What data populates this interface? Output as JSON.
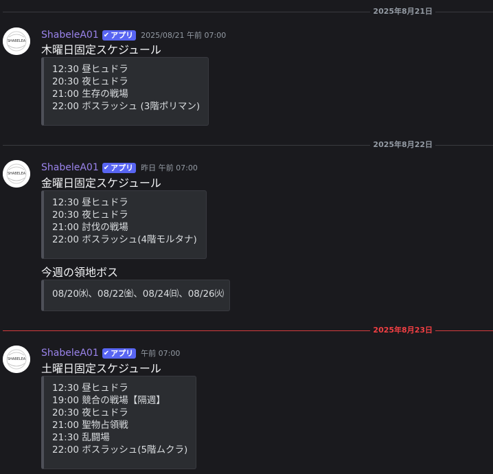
{
  "dividers": [
    {
      "label": "2025年8月21日",
      "today": false
    },
    {
      "label": "2025年8月22日",
      "today": false
    },
    {
      "label": "2025年8月23日",
      "today": true
    }
  ],
  "messages": [
    {
      "author": "ShabeleA01",
      "badge": "アプリ",
      "time": "2025/08/21 午前 07:00",
      "title": "木曜日固定スケジュール",
      "lines": [
        "12:30 昼ヒュドラ",
        "20:30 夜ヒュドラ",
        "21:00 生存の戦場",
        "22:00 ボスラッシュ (3階ポリマン)"
      ]
    },
    {
      "author": "ShabeleA01",
      "badge": "アプリ",
      "time": "昨日 午前 07:00",
      "title": "金曜日固定スケジュール",
      "lines": [
        "12:30 昼ヒュドラ",
        "20:30 夜ヒュドラ",
        "21:00 討伐の戦場",
        "22:00 ボスラッシュ(4階モルタナ)"
      ],
      "extra_title": "今週の領地ボス",
      "extra_lines": [
        "08/20㈬、08/22㈮、08/24㈰、08/26㈫"
      ]
    },
    {
      "author": "ShabeleA01",
      "badge": "アプリ",
      "time": "午前 07:00",
      "title": "土曜日固定スケジュール",
      "lines": [
        "12:30 昼ヒュドラ",
        "19:00 競合の戦場【隔週】",
        "20:30 夜ヒュドラ",
        "21:00 聖物占領戦",
        "21:30 乱闘場",
        "22:00 ボスラッシュ(5階ムクラ)"
      ]
    }
  ],
  "avatar_text": "SHABELEA",
  "colors": {
    "author": "#9b84ec",
    "badge": "#5865f2",
    "today_divider": "#f23f43"
  },
  "icons": {
    "badge_check": "checkmark-icon"
  }
}
